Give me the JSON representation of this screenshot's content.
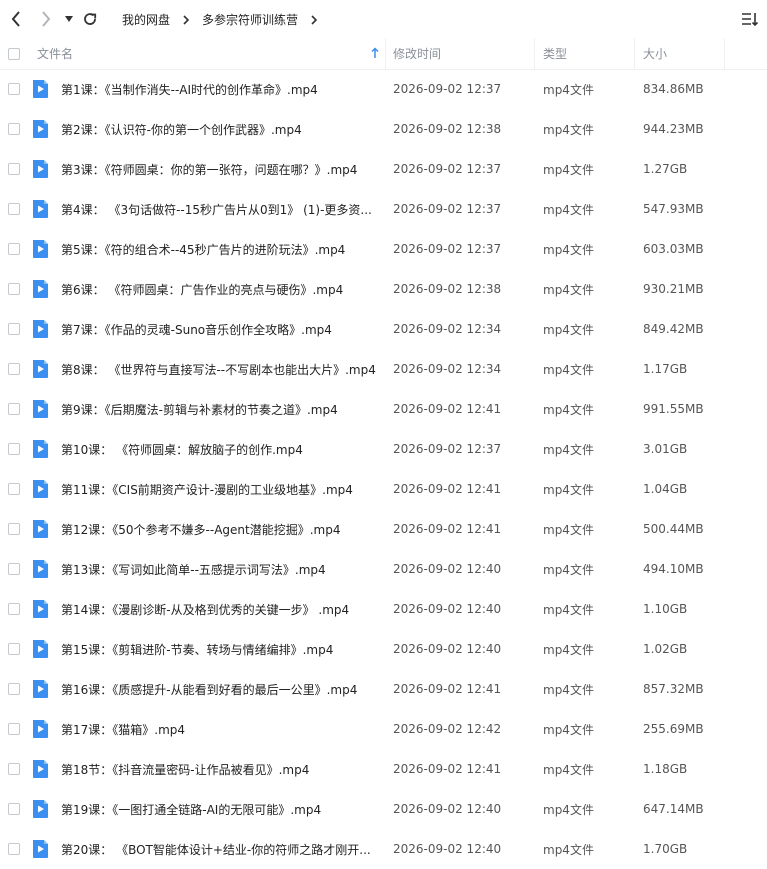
{
  "breadcrumb": [
    "我的网盘",
    "多参宗符师训练营"
  ],
  "columns": {
    "name": "文件名",
    "mtime": "修改时间",
    "type": "类型",
    "size": "大小"
  },
  "colors": {
    "accent": "#3b8ff0",
    "header_text": "#8a8f99"
  },
  "icons": {
    "file": "video-file-icon",
    "sort": "sort-asc-icon"
  },
  "files": [
    {
      "name": "第1课：《当制作消失--AI时代的创作革命》.mp4",
      "mtime": "2026-09-02 12:37",
      "type": "mp4文件",
      "size": "834.86MB"
    },
    {
      "name": "第2课：《认识符-你的第一个创作武器》.mp4",
      "mtime": "2026-09-02 12:38",
      "type": "mp4文件",
      "size": "944.23MB"
    },
    {
      "name": "第3课：《符师圆桌：你的第一张符，问题在哪？》.mp4",
      "mtime": "2026-09-02 12:37",
      "type": "mp4文件",
      "size": "1.27GB"
    },
    {
      "name": "第4课： 《3句话做符--15秒广告片从0到1》 (1)-更多资...",
      "mtime": "2026-09-02 12:37",
      "type": "mp4文件",
      "size": "547.93MB"
    },
    {
      "name": "第5课：《符的组合术--45秒广告片的进阶玩法》.mp4",
      "mtime": "2026-09-02 12:37",
      "type": "mp4文件",
      "size": "603.03MB"
    },
    {
      "name": "第6课： 《符师圆桌：广告作业的亮点与硬伤》.mp4",
      "mtime": "2026-09-02 12:38",
      "type": "mp4文件",
      "size": "930.21MB"
    },
    {
      "name": "第7课：《作品的灵魂-Suno音乐创作全攻略》.mp4",
      "mtime": "2026-09-02 12:34",
      "type": "mp4文件",
      "size": "849.42MB"
    },
    {
      "name": "第8课： 《世界符与直接写法--不写剧本也能出大片》.mp4",
      "mtime": "2026-09-02 12:34",
      "type": "mp4文件",
      "size": "1.17GB"
    },
    {
      "name": "第9课：《后期魔法-剪辑与补素材的节奏之道》.mp4",
      "mtime": "2026-09-02 12:41",
      "type": "mp4文件",
      "size": "991.55MB"
    },
    {
      "name": "第10课： 《符师圆桌：解放脑子的创作.mp4",
      "mtime": "2026-09-02 12:37",
      "type": "mp4文件",
      "size": "3.01GB"
    },
    {
      "name": "第11课：《CIS前期资产设计-漫剧的工业级地基》.mp4",
      "mtime": "2026-09-02 12:41",
      "type": "mp4文件",
      "size": "1.04GB"
    },
    {
      "name": "第12课：《50个参考不嫌多--Agent潜能挖掘》.mp4",
      "mtime": "2026-09-02 12:41",
      "type": "mp4文件",
      "size": "500.44MB"
    },
    {
      "name": "第13课：《写词如此简单--五感提示词写法》.mp4",
      "mtime": "2026-09-02 12:40",
      "type": "mp4文件",
      "size": "494.10MB"
    },
    {
      "name": "第14课：《漫剧诊断-从及格到优秀的关键一步》 .mp4",
      "mtime": "2026-09-02 12:40",
      "type": "mp4文件",
      "size": "1.10GB"
    },
    {
      "name": "第15课：《剪辑进阶-节奏、转场与情绪编排》.mp4",
      "mtime": "2026-09-02 12:40",
      "type": "mp4文件",
      "size": "1.02GB"
    },
    {
      "name": "第16课：《质感提升-从能看到好看的最后一公里》.mp4",
      "mtime": "2026-09-02 12:41",
      "type": "mp4文件",
      "size": "857.32MB"
    },
    {
      "name": "第17课：《猫箱》.mp4",
      "mtime": "2026-09-02 12:42",
      "type": "mp4文件",
      "size": "255.69MB"
    },
    {
      "name": "第18节：《抖音流量密码-让作品被看见》.mp4",
      "mtime": "2026-09-02 12:41",
      "type": "mp4文件",
      "size": "1.18GB"
    },
    {
      "name": "第19课：《一图打通全链路-AI的无限可能》.mp4",
      "mtime": "2026-09-02 12:40",
      "type": "mp4文件",
      "size": "647.14MB"
    },
    {
      "name": "第20课： 《BOT智能体设计+结业-你的符师之路才刚开...",
      "mtime": "2026-09-02 12:40",
      "type": "mp4文件",
      "size": "1.70GB"
    }
  ]
}
